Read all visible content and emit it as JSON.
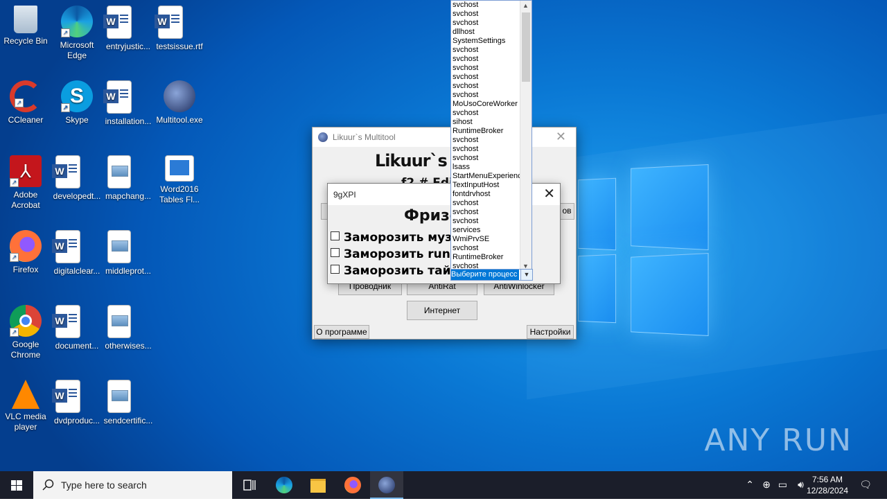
{
  "desktop": {
    "icons": [
      {
        "label": "Recycle Bin",
        "icon": "recycle-bin-icon"
      },
      {
        "label": "Microsoft Edge",
        "icon": "edge-icon"
      },
      {
        "label": "entryjustic...",
        "icon": "word-doc-icon"
      },
      {
        "label": "testsissue.rtf",
        "icon": "word-doc-icon"
      },
      {
        "label": "CCleaner",
        "icon": "ccleaner-icon"
      },
      {
        "label": "Skype",
        "icon": "skype-icon"
      },
      {
        "label": "installation...",
        "icon": "word-doc-icon"
      },
      {
        "label": "Multitool.exe",
        "icon": "multitool-icon"
      },
      {
        "label": "Adobe Acrobat",
        "icon": "acrobat-icon"
      },
      {
        "label": "developedt...",
        "icon": "word-doc-icon"
      },
      {
        "label": "mapchang...",
        "icon": "image-file-icon"
      },
      {
        "label": "Word2016 Tables Fl...",
        "icon": "word-table-icon"
      },
      {
        "label": "Firefox",
        "icon": "firefox-icon"
      },
      {
        "label": "digitalclear...",
        "icon": "word-doc-icon"
      },
      {
        "label": "middleprot...",
        "icon": "image-file-icon"
      },
      {
        "label": "Google Chrome",
        "icon": "chrome-icon"
      },
      {
        "label": "document...",
        "icon": "word-doc-icon"
      },
      {
        "label": "otherwises...",
        "icon": "image-file-icon"
      },
      {
        "label": "VLC media player",
        "icon": "vlc-icon"
      },
      {
        "label": "dvdproduc...",
        "icon": "word-doc-icon"
      },
      {
        "label": "sendcertific...",
        "icon": "image-file-icon"
      }
    ],
    "watermark": "ANY RUN"
  },
  "app": {
    "title": "Likuur`s Multitool",
    "heading": "Likuur`s M",
    "subheading": "f2 # Edi",
    "buttons": {
      "explorer": "Проводник",
      "antirat": "AntiRat",
      "antiwinlocker": "AntiWinlocker",
      "internet": "Интернет",
      "about": "О программе",
      "settings": "Настройки",
      "hidden_right": "ов"
    }
  },
  "dialog": {
    "title": "9gXPI",
    "heading": "Фризе",
    "options": [
      {
        "label": "Заморозить музы",
        "checked": false
      },
      {
        "label": "Заморозить runner",
        "checked": false
      },
      {
        "label": "Заморозить тайме",
        "checked": false
      }
    ]
  },
  "process_dropdown": {
    "selected": "Выберите процесс",
    "items": [
      "svchost",
      "svchost",
      "svchost",
      "dllhost",
      "SystemSettings",
      "svchost",
      "svchost",
      "svchost",
      "svchost",
      "svchost",
      "svchost",
      "MoUsoCoreWorker",
      "svchost",
      "sihost",
      "RuntimeBroker",
      "svchost",
      "svchost",
      "svchost",
      "lsass",
      "StartMenuExperienc",
      "TextInputHost",
      "fontdrvhost",
      "svchost",
      "svchost",
      "svchost",
      "services",
      "WmiPrvSE",
      "svchost",
      "RuntimeBroker",
      "svchost"
    ]
  },
  "taskbar": {
    "search_placeholder": "Type here to search",
    "time": "7:56 AM",
    "date": "12/28/2024",
    "pinned": [
      "task-view-icon",
      "edge-icon",
      "file-explorer-icon",
      "firefox-icon",
      "multitool-icon"
    ]
  }
}
